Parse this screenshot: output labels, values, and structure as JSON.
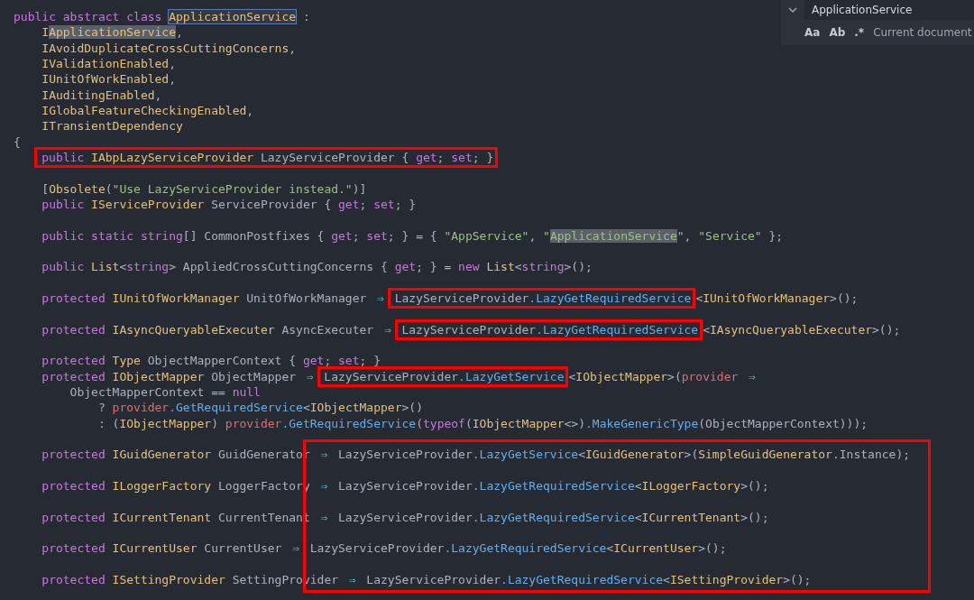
{
  "editor": {
    "lines": [
      {
        "kind": "code",
        "tokens": [
          {
            "kind": "kw",
            "text": "public abstract class "
          },
          {
            "kind": "type",
            "text": "ApplicationService",
            "match": true,
            "current": true
          },
          {
            "kind": "id",
            "text": " :"
          }
        ]
      },
      {
        "kind": "code",
        "tokens": [
          {
            "kind": "type",
            "text": "    I"
          },
          {
            "kind": "type",
            "text": "ApplicationService",
            "match": true,
            "current": false
          },
          {
            "kind": "id",
            "text": ","
          }
        ]
      },
      {
        "kind": "code",
        "tokens": [
          {
            "kind": "type",
            "text": "    IAvoidDuplicateCrossCuttingConcerns"
          },
          {
            "kind": "id",
            "text": ","
          }
        ]
      },
      {
        "kind": "code",
        "tokens": [
          {
            "kind": "type",
            "text": "    IValidationEnabled"
          },
          {
            "kind": "id",
            "text": ","
          }
        ]
      },
      {
        "kind": "code",
        "tokens": [
          {
            "kind": "type",
            "text": "    IUnitOfWorkEnabled"
          },
          {
            "kind": "id",
            "text": ","
          }
        ]
      },
      {
        "kind": "code",
        "tokens": [
          {
            "kind": "type",
            "text": "    IAuditingEnabled"
          },
          {
            "kind": "id",
            "text": ","
          }
        ]
      },
      {
        "kind": "code",
        "tokens": [
          {
            "kind": "type",
            "text": "    IGlobalFeatureCheckingEnabled"
          },
          {
            "kind": "id",
            "text": ","
          }
        ]
      },
      {
        "kind": "code",
        "tokens": [
          {
            "kind": "type",
            "text": "    ITransientDependency"
          }
        ]
      },
      {
        "kind": "code",
        "tokens": [
          {
            "kind": "id",
            "text": "{"
          }
        ]
      },
      {
        "kind": "code",
        "segments": [
          {
            "framed": true,
            "tokens": [
              {
                "kind": "kw",
                "text": "    public "
              },
              {
                "kind": "type",
                "text": "IAbpLazyServiceProvider"
              },
              {
                "kind": "id",
                "text": " LazyServiceProvider { "
              },
              {
                "kind": "kw",
                "text": "get"
              },
              {
                "kind": "id",
                "text": "; "
              },
              {
                "kind": "kw",
                "text": "set"
              },
              {
                "kind": "id",
                "text": "; }"
              }
            ]
          }
        ]
      },
      {
        "kind": "blank"
      },
      {
        "kind": "code",
        "tokens": [
          {
            "kind": "id",
            "text": "    ["
          },
          {
            "kind": "type",
            "text": "Obsolete"
          },
          {
            "kind": "id",
            "text": "("
          },
          {
            "kind": "str",
            "text": "\"Use LazyServiceProvider instead.\""
          },
          {
            "kind": "id",
            "text": ")]"
          }
        ]
      },
      {
        "kind": "code",
        "tokens": [
          {
            "kind": "kw",
            "text": "    public "
          },
          {
            "kind": "type",
            "text": "IServiceProvider"
          },
          {
            "kind": "id",
            "text": " ServiceProvider { "
          },
          {
            "kind": "kw",
            "text": "get"
          },
          {
            "kind": "id",
            "text": "; "
          },
          {
            "kind": "kw",
            "text": "set"
          },
          {
            "kind": "id",
            "text": "; }"
          }
        ]
      },
      {
        "kind": "blank"
      },
      {
        "kind": "code",
        "tokens": [
          {
            "kind": "kw",
            "text": "    public static string"
          },
          {
            "kind": "id",
            "text": "[] CommonPostfixes { "
          },
          {
            "kind": "kw",
            "text": "get"
          },
          {
            "kind": "id",
            "text": "; "
          },
          {
            "kind": "kw",
            "text": "set"
          },
          {
            "kind": "id",
            "text": "; } = { "
          },
          {
            "kind": "str",
            "text": "\"AppService\""
          },
          {
            "kind": "id",
            "text": ", "
          },
          {
            "kind": "str",
            "text": "\""
          },
          {
            "kind": "str",
            "text": "ApplicationService",
            "match": true,
            "current": false
          },
          {
            "kind": "str",
            "text": "\""
          },
          {
            "kind": "id",
            "text": ", "
          },
          {
            "kind": "str",
            "text": "\"Service\""
          },
          {
            "kind": "id",
            "text": " };"
          }
        ]
      },
      {
        "kind": "blank"
      },
      {
        "kind": "code",
        "tokens": [
          {
            "kind": "kw",
            "text": "    public "
          },
          {
            "kind": "type",
            "text": "List"
          },
          {
            "kind": "id",
            "text": "<"
          },
          {
            "kind": "kw",
            "text": "string"
          },
          {
            "kind": "id",
            "text": "> AppliedCrossCuttingConcerns { "
          },
          {
            "kind": "kw",
            "text": "get"
          },
          {
            "kind": "id",
            "text": "; } = "
          },
          {
            "kind": "kw",
            "text": "new "
          },
          {
            "kind": "type",
            "text": "List"
          },
          {
            "kind": "id",
            "text": "<"
          },
          {
            "kind": "kw",
            "text": "string"
          },
          {
            "kind": "id",
            "text": ">();"
          }
        ]
      },
      {
        "kind": "blank"
      },
      {
        "kind": "code",
        "segments": [
          {
            "framed": false,
            "tokens": [
              {
                "kind": "kw",
                "text": "    protected "
              },
              {
                "kind": "type",
                "text": "IUnitOfWorkManager"
              },
              {
                "kind": "id",
                "text": " UnitOfWorkManager "
              },
              {
                "kind": "op",
                "text": "⇒"
              }
            ]
          },
          {
            "framed": true,
            "tokens": [
              {
                "kind": "id",
                "text": "LazyServiceProvider"
              },
              {
                "kind": "method",
                "text": ".LazyGetRequiredService"
              }
            ]
          },
          {
            "framed": false,
            "tokens": [
              {
                "kind": "id",
                "text": "<"
              },
              {
                "kind": "type",
                "text": "IUnitOfWorkManager"
              },
              {
                "kind": "id",
                "text": ">();"
              }
            ]
          }
        ]
      },
      {
        "kind": "blank"
      },
      {
        "kind": "code",
        "segments": [
          {
            "framed": false,
            "tokens": [
              {
                "kind": "kw",
                "text": "    protected "
              },
              {
                "kind": "type",
                "text": "IAsyncQueryableExecuter"
              },
              {
                "kind": "id",
                "text": " AsyncExecuter "
              },
              {
                "kind": "op",
                "text": "⇒"
              }
            ]
          },
          {
            "framed": true,
            "tokens": [
              {
                "kind": "id",
                "text": "LazyServiceProvider"
              },
              {
                "kind": "method",
                "text": ".LazyGetRequiredService"
              }
            ]
          },
          {
            "framed": false,
            "tokens": [
              {
                "kind": "id",
                "text": "<"
              },
              {
                "kind": "type",
                "text": "IAsyncQueryableExecuter"
              },
              {
                "kind": "id",
                "text": ">();"
              }
            ]
          }
        ]
      },
      {
        "kind": "blank"
      },
      {
        "kind": "code",
        "tokens": [
          {
            "kind": "kw",
            "text": "    protected "
          },
          {
            "kind": "type",
            "text": "Type"
          },
          {
            "kind": "id",
            "text": " ObjectMapperContext { "
          },
          {
            "kind": "kw",
            "text": "get"
          },
          {
            "kind": "id",
            "text": "; "
          },
          {
            "kind": "kw",
            "text": "set"
          },
          {
            "kind": "id",
            "text": "; }"
          }
        ]
      },
      {
        "kind": "code",
        "segments": [
          {
            "framed": false,
            "tokens": [
              {
                "kind": "kw",
                "text": "    protected "
              },
              {
                "kind": "type",
                "text": "IObjectMapper"
              },
              {
                "kind": "id",
                "text": " ObjectMapper "
              },
              {
                "kind": "op",
                "text": "⇒"
              }
            ]
          },
          {
            "framed": true,
            "tokens": [
              {
                "kind": "id",
                "text": "LazyServiceProvider"
              },
              {
                "kind": "method",
                "text": ".LazyGetService"
              }
            ]
          },
          {
            "framed": false,
            "tokens": [
              {
                "kind": "id",
                "text": "<"
              },
              {
                "kind": "type",
                "text": "IObjectMapper"
              },
              {
                "kind": "id",
                "text": ">("
              },
              {
                "kind": "param",
                "text": "provider "
              },
              {
                "kind": "op",
                "text": "⇒"
              }
            ]
          }
        ]
      },
      {
        "kind": "code",
        "tokens": [
          {
            "kind": "id",
            "text": "        ObjectMapperContext == "
          },
          {
            "kind": "kw",
            "text": "null"
          }
        ]
      },
      {
        "kind": "code",
        "tokens": [
          {
            "kind": "id",
            "text": "            ? "
          },
          {
            "kind": "param",
            "text": "provider"
          },
          {
            "kind": "method",
            "text": ".GetRequiredService"
          },
          {
            "kind": "id",
            "text": "<"
          },
          {
            "kind": "type",
            "text": "IObjectMapper"
          },
          {
            "kind": "id",
            "text": ">()"
          }
        ]
      },
      {
        "kind": "code",
        "tokens": [
          {
            "kind": "id",
            "text": "            : ("
          },
          {
            "kind": "type",
            "text": "IObjectMapper"
          },
          {
            "kind": "id",
            "text": ") "
          },
          {
            "kind": "param",
            "text": "provider"
          },
          {
            "kind": "method",
            "text": ".GetRequiredService"
          },
          {
            "kind": "id",
            "text": "("
          },
          {
            "kind": "kw",
            "text": "typeof"
          },
          {
            "kind": "id",
            "text": "("
          },
          {
            "kind": "type",
            "text": "IObjectMapper"
          },
          {
            "kind": "id",
            "text": "<>)"
          },
          {
            "kind": "method",
            "text": ".MakeGenericType"
          },
          {
            "kind": "id",
            "text": "(ObjectMapperContext)));"
          }
        ]
      },
      {
        "kind": "blank"
      },
      {
        "kind": "code",
        "tokens": [
          {
            "kind": "kw",
            "text": "    protected "
          },
          {
            "kind": "type",
            "text": "IGuidGenerator"
          },
          {
            "kind": "id",
            "text": " GuidGenerator "
          },
          {
            "kind": "op",
            "text": "⇒"
          },
          {
            "kind": "id",
            "text": " LazyServiceProvider"
          },
          {
            "kind": "method",
            "text": ".LazyGetService"
          },
          {
            "kind": "id",
            "text": "<"
          },
          {
            "kind": "type",
            "text": "IGuidGenerator"
          },
          {
            "kind": "id",
            "text": ">("
          },
          {
            "kind": "type",
            "text": "SimpleGuidGenerator"
          },
          {
            "kind": "id",
            "text": ".Instance);"
          }
        ]
      },
      {
        "kind": "blank"
      },
      {
        "kind": "code",
        "tokens": [
          {
            "kind": "kw",
            "text": "    protected "
          },
          {
            "kind": "type",
            "text": "ILoggerFactory"
          },
          {
            "kind": "id",
            "text": " LoggerFactory "
          },
          {
            "kind": "op",
            "text": "⇒"
          },
          {
            "kind": "id",
            "text": " LazyServiceProvider"
          },
          {
            "kind": "method",
            "text": ".LazyGetRequiredService"
          },
          {
            "kind": "id",
            "text": "<"
          },
          {
            "kind": "type",
            "text": "ILoggerFactory"
          },
          {
            "kind": "id",
            "text": ">();"
          }
        ]
      },
      {
        "kind": "blank"
      },
      {
        "kind": "code",
        "tokens": [
          {
            "kind": "kw",
            "text": "    protected "
          },
          {
            "kind": "type",
            "text": "ICurrentTenant"
          },
          {
            "kind": "id",
            "text": " CurrentTenant "
          },
          {
            "kind": "op",
            "text": "⇒"
          },
          {
            "kind": "id",
            "text": " LazyServiceProvider"
          },
          {
            "kind": "method",
            "text": ".LazyGetRequiredService"
          },
          {
            "kind": "id",
            "text": "<"
          },
          {
            "kind": "type",
            "text": "ICurrentTenant"
          },
          {
            "kind": "id",
            "text": ">();"
          }
        ]
      },
      {
        "kind": "blank"
      },
      {
        "kind": "code",
        "tokens": [
          {
            "kind": "kw",
            "text": "    protected "
          },
          {
            "kind": "type",
            "text": "ICurrentUser"
          },
          {
            "kind": "id",
            "text": " CurrentUser "
          },
          {
            "kind": "op",
            "text": "⇒"
          },
          {
            "kind": "id",
            "text": " LazyServiceProvider"
          },
          {
            "kind": "method",
            "text": ".LazyGetRequiredService"
          },
          {
            "kind": "id",
            "text": "<"
          },
          {
            "kind": "type",
            "text": "ICurrentUser"
          },
          {
            "kind": "id",
            "text": ">();"
          }
        ]
      },
      {
        "kind": "blank"
      },
      {
        "kind": "code",
        "tokens": [
          {
            "kind": "kw",
            "text": "    protected "
          },
          {
            "kind": "type",
            "text": "ISettingProvider"
          },
          {
            "kind": "id",
            "text": " SettingProvider "
          },
          {
            "kind": "op",
            "text": "⇒"
          },
          {
            "kind": "id",
            "text": " LazyServiceProvider"
          },
          {
            "kind": "method",
            "text": ".LazyGetRequiredService"
          },
          {
            "kind": "id",
            "text": "<"
          },
          {
            "kind": "type",
            "text": "ISettingProvider"
          },
          {
            "kind": "id",
            "text": ">();"
          }
        ]
      }
    ]
  },
  "find": {
    "query": "ApplicationService",
    "options": [
      {
        "text": "Aa"
      },
      {
        "text": "Ab"
      },
      {
        "text": ".*"
      }
    ],
    "scope": "Current document"
  }
}
